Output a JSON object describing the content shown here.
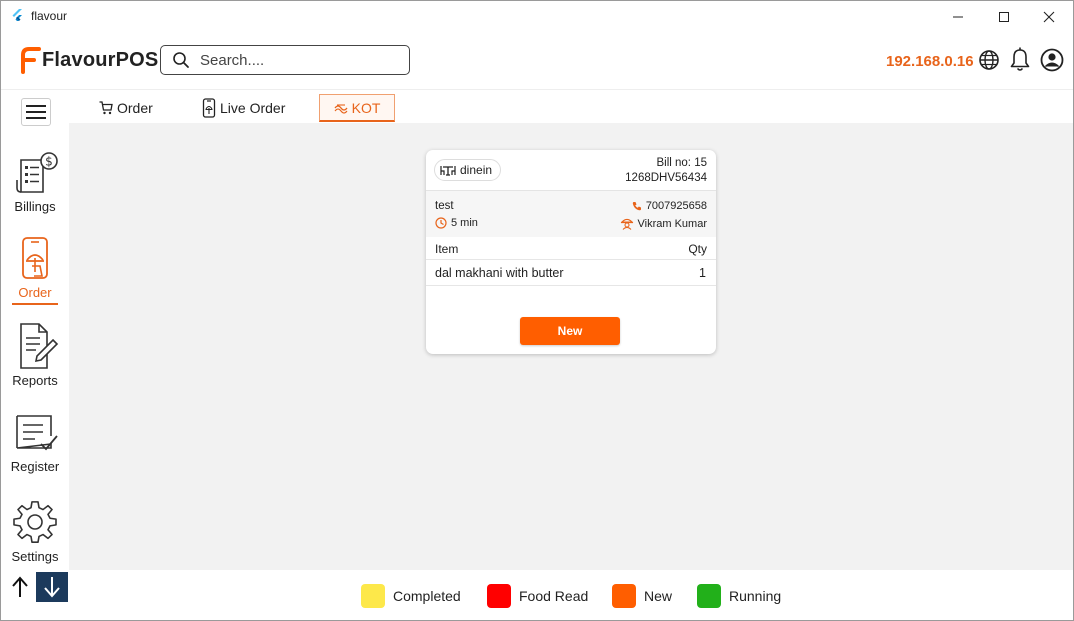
{
  "window": {
    "title": "flavour",
    "minimize": "—",
    "maximize": "☐",
    "close": "✕"
  },
  "header": {
    "logo_text": "FlavourPOS",
    "search_placeholder": "Search....",
    "ip_address": "192.168.0.16",
    "icons": [
      "globe-icon",
      "bell-icon",
      "user-icon"
    ]
  },
  "sidebar": {
    "items": [
      {
        "label": "Billings",
        "icon": "billing-icon"
      },
      {
        "label": "Order",
        "icon": "order-icon",
        "active": true
      },
      {
        "label": "Reports",
        "icon": "reports-icon"
      },
      {
        "label": "Register",
        "icon": "register-icon"
      },
      {
        "label": "Settings",
        "icon": "settings-icon"
      }
    ]
  },
  "tabs": [
    {
      "label": "Order",
      "icon": "cart-icon"
    },
    {
      "label": "Live Order",
      "icon": "phone-icon"
    },
    {
      "label": "KOT",
      "icon": "kot-icon",
      "active": true
    }
  ],
  "kot_card": {
    "order_type": "dinein",
    "bill_no": "Bill no: 15",
    "bill_code": "1268DHV56434",
    "customer_name": "test",
    "elapsed": "5 min",
    "phone": "7007925658",
    "waiter": "Vikram Kumar",
    "columns": {
      "item": "Item",
      "qty": "Qty"
    },
    "items": [
      {
        "name": "dal makhani with butter",
        "qty": "1"
      }
    ],
    "status_button": "New"
  },
  "legend": [
    {
      "label": "Completed",
      "color": "#fde84a"
    },
    {
      "label": "Food Read",
      "color": "#ff0000"
    },
    {
      "label": "New",
      "color": "#ff5e00"
    },
    {
      "label": "Running",
      "color": "#22b01a"
    }
  ],
  "colors": {
    "accent": "#e8641b",
    "button": "#ff5e00",
    "dark_button": "#1c3a5c"
  }
}
